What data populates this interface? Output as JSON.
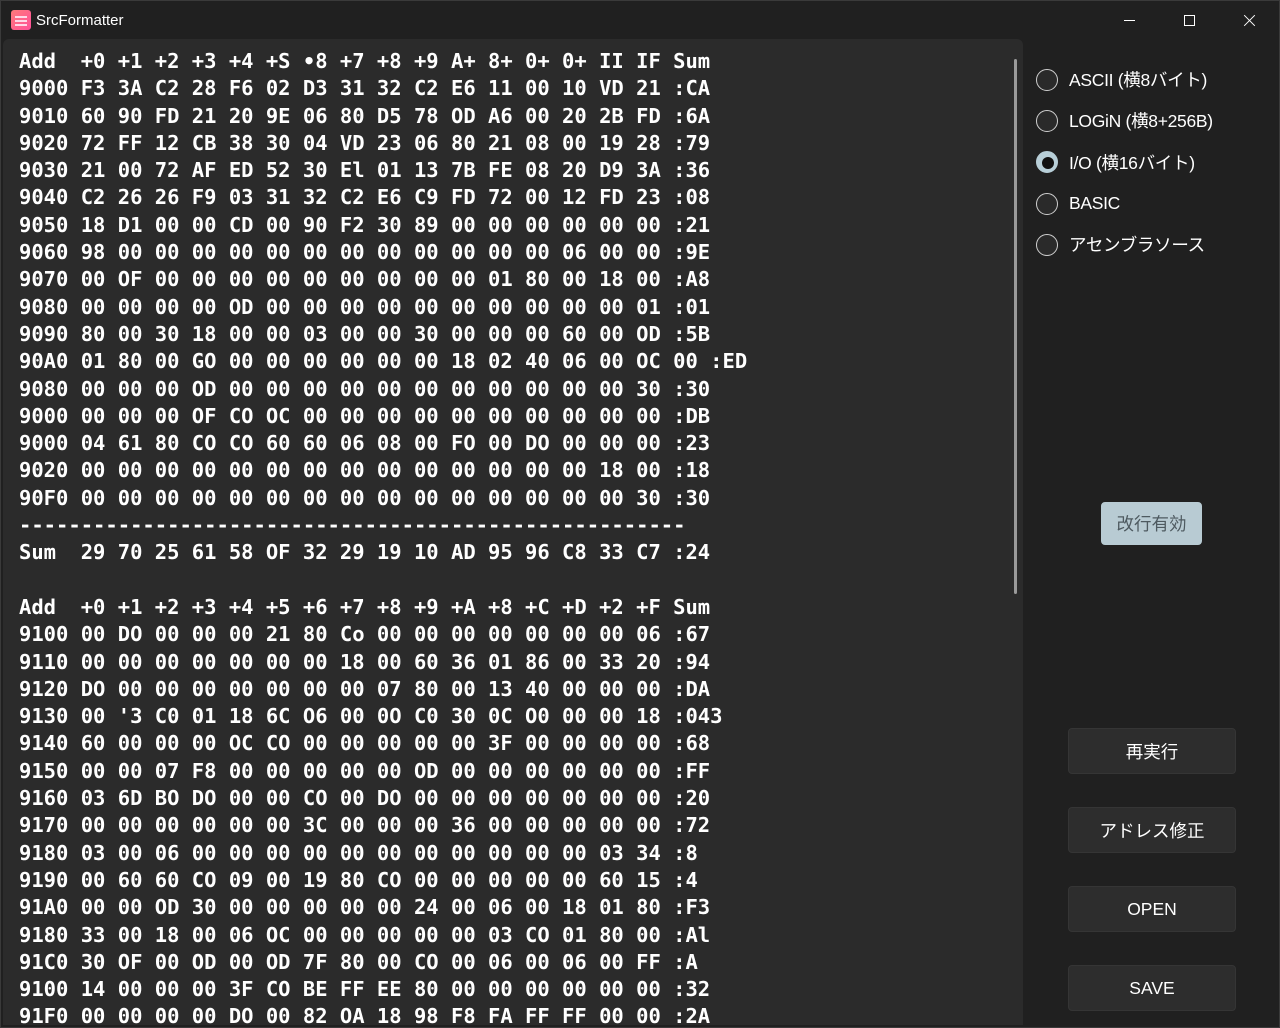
{
  "window": {
    "title": "SrcFormatter"
  },
  "editor": {
    "content": "Add  +0 +1 +2 +3 +4 +S •8 +7 +8 +9 A+ 8+ 0+ 0+ II IF Sum\n9000 F3 3A C2 28 F6 02 D3 31 32 C2 E6 11 00 10 VD 21 :CA\n9010 60 90 FD 21 20 9E 06 80 D5 78 OD A6 00 20 2B FD :6A\n9020 72 FF 12 CB 38 30 04 VD 23 06 80 21 08 00 19 28 :79\n9030 21 00 72 AF ED 52 30 El 01 13 7B FE 08 20 D9 3A :36\n9040 C2 26 26 F9 03 31 32 C2 E6 C9 FD 72 00 12 FD 23 :08\n9050 18 D1 00 00 CD 00 90 F2 30 89 00 00 00 00 00 00 :21\n9060 98 00 00 00 00 00 00 00 00 00 00 00 00 06 00 00 :9E\n9070 00 OF 00 00 00 00 00 00 00 00 00 01 80 00 18 00 :A8\n9080 00 00 00 00 OD 00 00 00 00 00 00 00 00 00 00 01 :01\n9090 80 00 30 18 00 00 03 00 00 30 00 00 00 60 00 OD :5B\n90A0 01 80 00 GO 00 00 00 00 00 00 18 02 40 06 00 OC 00 :ED\n9080 00 00 00 OD 00 00 00 00 00 00 00 00 00 00 00 30 :30\n9000 00 00 00 OF CO OC 00 00 00 00 00 00 00 00 00 00 :DB\n9000 04 61 80 CO CO 60 60 06 08 00 FO 00 DO 00 00 00 :23\n9020 00 00 00 00 00 00 00 00 00 00 00 00 00 00 18 00 :18\n90F0 00 00 00 00 00 00 00 00 00 00 00 00 00 00 00 30 :30\n------------------------------------------------------\nSum  29 70 25 61 58 OF 32 29 19 10 AD 95 96 C8 33 C7 :24\n\nAdd  +0 +1 +2 +3 +4 +5 +6 +7 +8 +9 +A +8 +C +D +2 +F Sum\n9100 00 DO 00 00 00 21 80 Co 00 00 00 00 00 00 00 06 :67\n9110 00 00 00 00 00 00 00 18 00 60 36 01 86 00 33 20 :94\n9120 DO 00 00 00 00 00 00 00 07 80 00 13 40 00 00 00 :DA\n9130 00 '3 C0 01 18 6C O6 00 0O C0 30 0C O0 00 00 18 :043\n9140 60 00 00 00 OC CO 00 00 00 00 00 3F 00 00 00 00 :68\n9150 00 00 07 F8 00 00 00 00 00 OD 00 00 00 00 00 00 :FF\n9160 03 6D BO DO 00 00 CO 00 DO 00 00 00 00 00 00 00 :20\n9170 00 00 00 00 00 00 3C 00 00 00 36 00 00 00 00 00 :72\n9180 03 00 06 00 00 00 00 00 00 00 00 00 00 00 03 34 :8\n9190 00 60 60 CO 09 00 19 80 CO 00 00 00 00 00 60 15 :4\n91A0 00 00 OD 30 00 00 00 00 00 24 00 06 00 18 01 80 :F3\n9180 33 00 18 00 06 OC 00 00 00 00 00 03 CO 01 80 00 :Al\n91C0 30 OF 00 OD 00 OD 7F 80 00 CO 00 06 00 06 00 FF :A\n9100 14 00 00 00 3F CO BE FF EE 80 00 00 00 00 00 00 :32\n91F0 00 00 00 00 DO 00 82 OA 18 98 F8 FA FF FF 00 00 :2A"
  },
  "format_options": [
    {
      "label": "ASCII (横8バイト)",
      "checked": false
    },
    {
      "label": "LOGiN (横8+256B)",
      "checked": false
    },
    {
      "label": "I/O (横16バイト)",
      "checked": true
    },
    {
      "label": "BASIC",
      "checked": false
    },
    {
      "label": "アセンブラソース",
      "checked": false
    }
  ],
  "buttons": {
    "newline_toggle": "改行有効",
    "rerun": "再実行",
    "fix_address": "アドレス修正",
    "open": "OPEN",
    "save": "SAVE"
  },
  "colors": {
    "background": "#202020",
    "editor_background": "#2b2b2b",
    "accent": "#b8cbd3",
    "text": "#ffffff"
  }
}
